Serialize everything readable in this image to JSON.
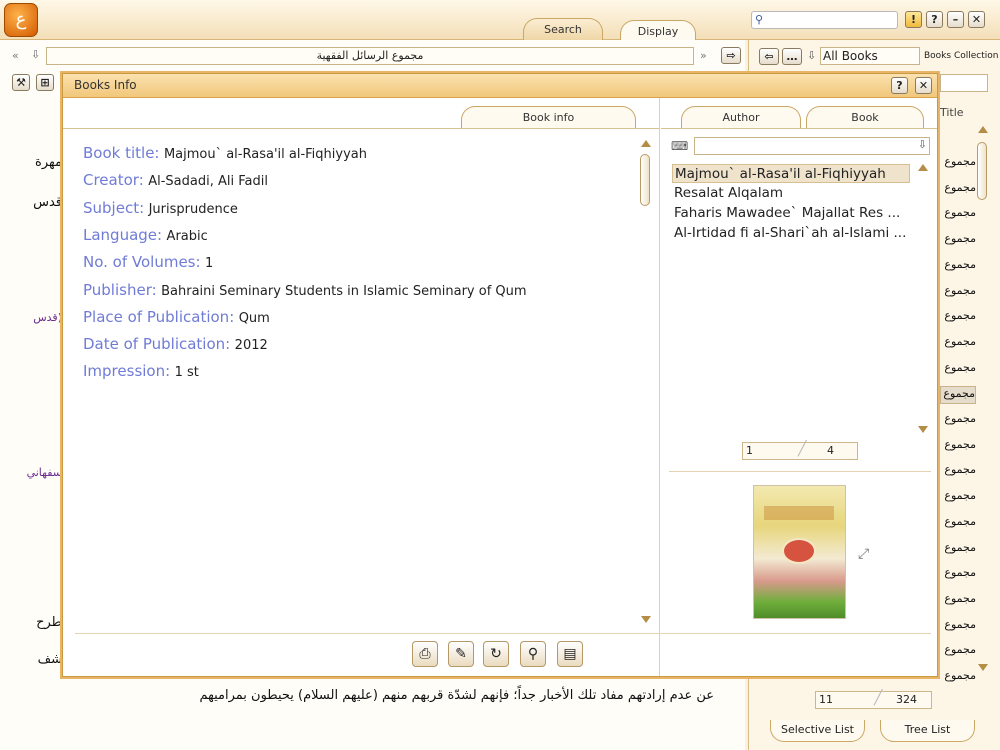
{
  "header": {
    "tabs": [
      "Search",
      "Display"
    ],
    "active_tab": "Display"
  },
  "nav": {
    "book_field": "مجموع الرسائل الفقهية",
    "all_books": "All Books",
    "books_collection": "Books Collection",
    "title_header": "Title"
  },
  "main_text": {
    "lines": [
      "مهرة",
      "قدس",
      "(قدس",
      "سفهاني",
      "طرح",
      "شف",
      "عن عدم إرادتهم مفاد تلك الأخبار جداً؛ فإنهم لشدّة قربهم منهم (عليهم السلام) يحيطون بمراميهم"
    ]
  },
  "dialog": {
    "title": "Books Info",
    "tab_book_info": "Book info",
    "tab_author": "Author",
    "tab_book": "Book",
    "fields": [
      {
        "label": "Book title:",
        "value": "Majmou` al-Rasa'il al-Fiqhiyyah"
      },
      {
        "label": "Creator:",
        "value": "Al-Sadadi, Ali Fadil"
      },
      {
        "label": "Subject:",
        "value": "Jurisprudence"
      },
      {
        "label": "Language:",
        "value": "Arabic"
      },
      {
        "label": "No. of Volumes:",
        "value": "1"
      },
      {
        "label": "Publisher:",
        "value": "Bahraini Seminary Students in Islamic Seminary of Qum"
      },
      {
        "label": "Place of Publication:",
        "value": "Qum"
      },
      {
        "label": "Date of Publication:",
        "value": "2012"
      },
      {
        "label": "Impression:",
        "value": "1 st"
      }
    ],
    "book_list": [
      "Majmou` al-Rasa'il al-Fiqhiyyah",
      "Resalat Alqalam",
      "Faharis Mawadee` Majallat Res ...",
      "Al-Irtidad fi al-Shari`ah al-Islami ..."
    ],
    "pager_current": "1",
    "pager_total": "4",
    "help_label": "?",
    "close_label": "✕"
  },
  "right_list": {
    "items": [
      "مجموع",
      "مجموع",
      "مجموع",
      "مجموع",
      "مجموع",
      "مجموع",
      "مجموع",
      "مجموع",
      "مجموع",
      "مجموع",
      "مجموع",
      "مجموع",
      "مجموع",
      "مجموع",
      "مجموع",
      "مجموع",
      "مجموع",
      "مجموع",
      "مجموع",
      "مجموع",
      "مجموع"
    ],
    "selected_index": 9,
    "pager_current": "11",
    "pager_total": "324",
    "bottom_tabs": [
      "Selective List",
      "Tree List"
    ]
  },
  "colors": {
    "accent": "#e7b46a",
    "label_blue": "#6f7bd6",
    "purple_text": "#6b2b8f"
  }
}
